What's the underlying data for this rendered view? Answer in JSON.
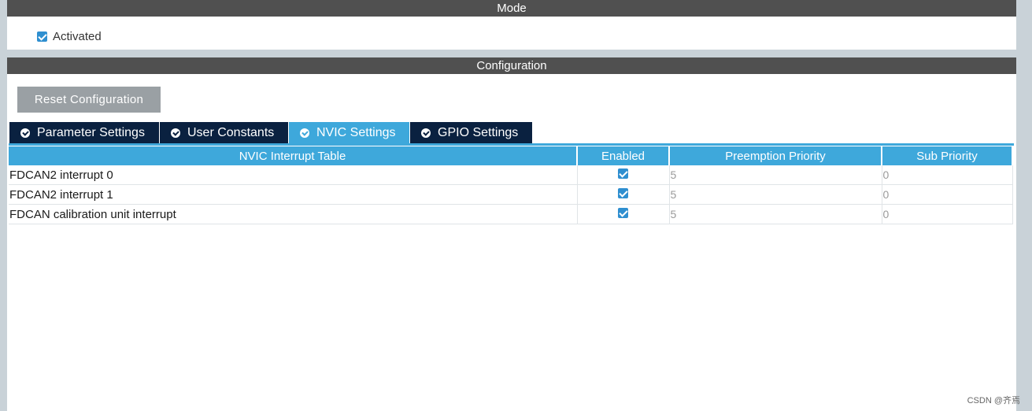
{
  "mode": {
    "title": "Mode",
    "activated_label": "Activated",
    "activated_checked": true
  },
  "configuration": {
    "title": "Configuration",
    "reset_label": "Reset Configuration",
    "tabs": [
      {
        "label": "Parameter Settings",
        "active": false
      },
      {
        "label": "User Constants",
        "active": false
      },
      {
        "label": "NVIC Settings",
        "active": true
      },
      {
        "label": "GPIO Settings",
        "active": false
      }
    ]
  },
  "nvic_table": {
    "headers": [
      "NVIC Interrupt Table",
      "Enabled",
      "Preemption Priority",
      "Sub Priority"
    ],
    "rows": [
      {
        "name": "FDCAN2 interrupt 0",
        "enabled": true,
        "preemption": "5",
        "sub": "0"
      },
      {
        "name": "FDCAN2 interrupt 1",
        "enabled": true,
        "preemption": "5",
        "sub": "0"
      },
      {
        "name": "FDCAN calibration unit interrupt",
        "enabled": true,
        "preemption": "5",
        "sub": "0"
      }
    ]
  },
  "watermark": "CSDN @齐焉",
  "colors": {
    "header_bar": "#505050",
    "tab_dark": "#0a2140",
    "accent_blue": "#3ea8db",
    "checkbox_blue": "#2f8fd0",
    "button_gray": "#9aa0a4"
  }
}
